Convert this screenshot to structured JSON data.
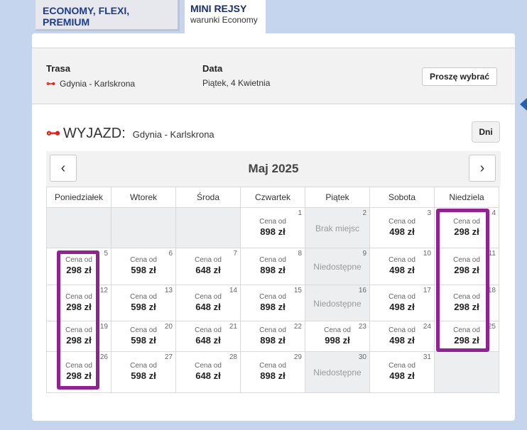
{
  "tabs": [
    {
      "label": "ECONOMY, FLEXI, PREMIUM",
      "sub": ""
    },
    {
      "label": "MINI REJSY",
      "sub": "warunki Economy"
    }
  ],
  "info": {
    "route_label": "Trasa",
    "route_value": "Gdynia - Karlskrona",
    "date_label": "Data",
    "date_value": "Piątek, 4 Kwietnia",
    "choose_button": "Proszę wybrać"
  },
  "departure": {
    "arrow_icon": "⊶",
    "title": "WYJAZD:",
    "route": "Gdynia - Karlskrona",
    "days_button": "Dni"
  },
  "calendar": {
    "month": "Maj 2025",
    "prev_icon": "‹",
    "next_icon": "›",
    "weekdays": [
      "Poniedziałek",
      "Wtorek",
      "Środa",
      "Czwartek",
      "Piątek",
      "Sobota",
      "Niedziela"
    ],
    "price_label": "Cena od",
    "weeks": [
      [
        {
          "day": "",
          "status": "blank"
        },
        {
          "day": "",
          "status": "blank"
        },
        {
          "day": "",
          "status": "blank"
        },
        {
          "day": "1",
          "status": "price",
          "price": "898 zł"
        },
        {
          "day": "2",
          "status": "na",
          "text": "Brak miejsc"
        },
        {
          "day": "3",
          "status": "price",
          "price": "498 zł"
        },
        {
          "day": "4",
          "status": "price",
          "price": "298 zł"
        }
      ],
      [
        {
          "day": "5",
          "status": "price",
          "price": "298 zł"
        },
        {
          "day": "6",
          "status": "price",
          "price": "598 zł"
        },
        {
          "day": "7",
          "status": "price",
          "price": "648 zł"
        },
        {
          "day": "8",
          "status": "price",
          "price": "898 zł"
        },
        {
          "day": "9",
          "status": "na",
          "text": "Niedostępne"
        },
        {
          "day": "10",
          "status": "price",
          "price": "498 zł"
        },
        {
          "day": "11",
          "status": "price",
          "price": "298 zł"
        }
      ],
      [
        {
          "day": "12",
          "status": "price",
          "price": "298 zł"
        },
        {
          "day": "13",
          "status": "price",
          "price": "598 zł"
        },
        {
          "day": "14",
          "status": "price",
          "price": "648 zł"
        },
        {
          "day": "15",
          "status": "price",
          "price": "898 zł"
        },
        {
          "day": "16",
          "status": "na",
          "text": "Niedostępne"
        },
        {
          "day": "17",
          "status": "price",
          "price": "498 zł"
        },
        {
          "day": "18",
          "status": "price",
          "price": "298 zł"
        }
      ],
      [
        {
          "day": "19",
          "status": "price",
          "price": "298 zł"
        },
        {
          "day": "20",
          "status": "price",
          "price": "598 zł"
        },
        {
          "day": "21",
          "status": "price",
          "price": "648 zł"
        },
        {
          "day": "22",
          "status": "price",
          "price": "898 zł"
        },
        {
          "day": "23",
          "status": "price",
          "price": "998 zł"
        },
        {
          "day": "24",
          "status": "price",
          "price": "498 zł"
        },
        {
          "day": "25",
          "status": "price",
          "price": "298 zł"
        }
      ],
      [
        {
          "day": "26",
          "status": "price",
          "price": "298 zł"
        },
        {
          "day": "27",
          "status": "price",
          "price": "598 zł"
        },
        {
          "day": "28",
          "status": "price",
          "price": "648 zł"
        },
        {
          "day": "29",
          "status": "price",
          "price": "898 zł"
        },
        {
          "day": "30",
          "status": "na",
          "text": "Niedostępne"
        },
        {
          "day": "31",
          "status": "price",
          "price": "498 zł"
        },
        {
          "day": "",
          "status": "blank"
        }
      ]
    ]
  },
  "colors": {
    "accent_red": "#d9261c",
    "highlight_purple": "#8e2391",
    "tab_blue": "#1d3b8b"
  }
}
